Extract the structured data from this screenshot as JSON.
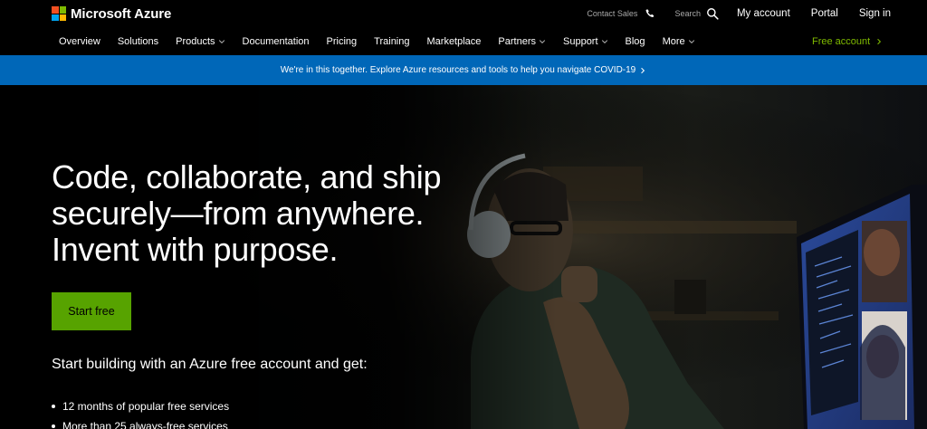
{
  "header": {
    "brand_name": "Microsoft Azure",
    "logo_colors": [
      "#f25022",
      "#7fba00",
      "#00a4ef",
      "#ffb900"
    ],
    "contact_sales": "Contact Sales",
    "search_label": "Search",
    "utility_links": [
      "My account",
      "Portal",
      "Sign in"
    ]
  },
  "nav": {
    "items": [
      {
        "label": "Overview",
        "dropdown": false
      },
      {
        "label": "Solutions",
        "dropdown": false
      },
      {
        "label": "Products",
        "dropdown": true
      },
      {
        "label": "Documentation",
        "dropdown": false
      },
      {
        "label": "Pricing",
        "dropdown": false
      },
      {
        "label": "Training",
        "dropdown": false
      },
      {
        "label": "Marketplace",
        "dropdown": false
      },
      {
        "label": "Partners",
        "dropdown": true
      },
      {
        "label": "Support",
        "dropdown": true
      },
      {
        "label": "Blog",
        "dropdown": false
      },
      {
        "label": "More",
        "dropdown": true
      }
    ],
    "free_account": "Free account",
    "free_account_color": "#7fba00"
  },
  "banner": {
    "text": "We're in this together. Explore Azure resources and tools to help you navigate COVID-19",
    "background": "#0067b8"
  },
  "hero": {
    "title_lines": [
      "Code, collaborate, and ship",
      "securely—from anywhere.",
      "Invent with purpose."
    ],
    "cta_label": "Start free",
    "cta_color": "#57a300",
    "subtitle": "Start building with an Azure free account and get:",
    "benefits": [
      "12 months of popular free services",
      "More than 25 always-free services"
    ]
  }
}
